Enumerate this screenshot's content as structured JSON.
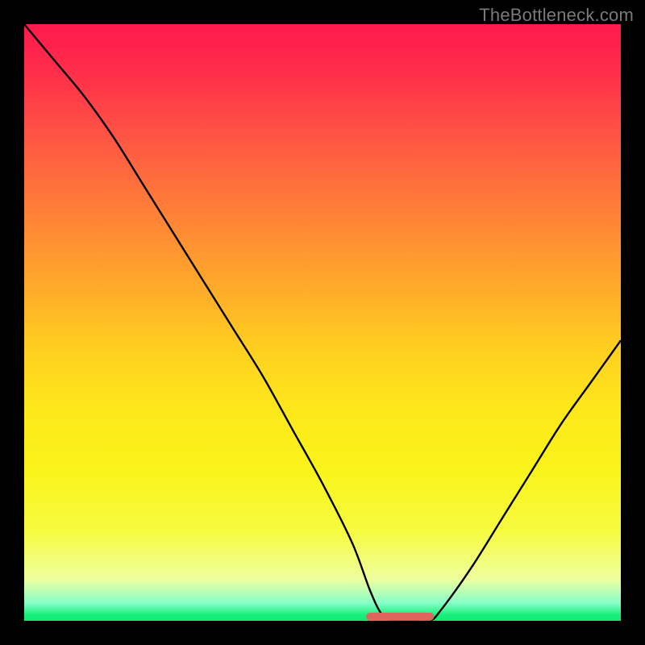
{
  "watermark": "TheBottleneck.com",
  "chart_data": {
    "type": "line",
    "title": "",
    "xlabel": "",
    "ylabel": "",
    "xlim": [
      0,
      100
    ],
    "ylim": [
      0,
      100
    ],
    "x": [
      0,
      5,
      10,
      15,
      20,
      25,
      30,
      35,
      40,
      45,
      50,
      55,
      58,
      60,
      62,
      65,
      68,
      70,
      75,
      80,
      85,
      90,
      95,
      100
    ],
    "values": [
      100,
      94,
      88,
      81,
      73,
      65,
      57,
      49,
      41,
      32,
      23,
      13,
      5,
      1,
      0,
      0,
      0,
      2,
      9,
      17,
      25,
      33,
      40,
      47
    ],
    "flat_segment": {
      "x_start": 58,
      "x_end": 68,
      "y": 0.7,
      "color": "#dd655e"
    }
  }
}
